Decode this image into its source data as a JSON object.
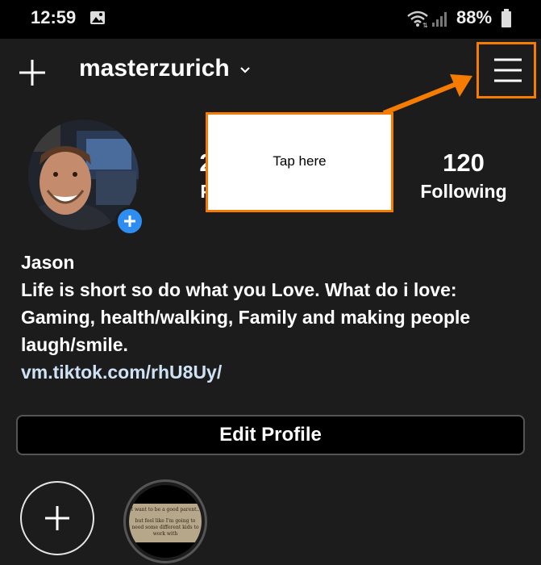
{
  "status_bar": {
    "time": "12:59",
    "battery": "88%",
    "icons": [
      "gallery-icon",
      "wifi-icon",
      "signal-icon",
      "battery-icon"
    ]
  },
  "header": {
    "username": "masterzurich",
    "icons": [
      "plus-icon",
      "chevron-down-icon",
      "hamburger-menu-icon"
    ]
  },
  "stats": {
    "posts_partial": "2",
    "posts_label_partial": "P",
    "following_count": "120",
    "following_label": "Following"
  },
  "annotation": {
    "callout_text": "Tap here",
    "highlight_color": "#f57c00"
  },
  "bio": {
    "name": "Jason",
    "text": "Life is short so do what you Love. What do i love: Gaming, health/walking, Family and making people laugh/smile.",
    "link": "vm.tiktok.com/rhU8Uy/"
  },
  "buttons": {
    "edit_profile": "Edit Profile"
  },
  "highlight": {
    "line1": "I want to be a good parent..",
    "line2": "but feel like I'm going to need some different kids to work with"
  },
  "colors": {
    "background": "#1c1c1c",
    "status_bar": "#000000",
    "accent_blue": "#2e8df0",
    "orange": "#f57c00"
  }
}
